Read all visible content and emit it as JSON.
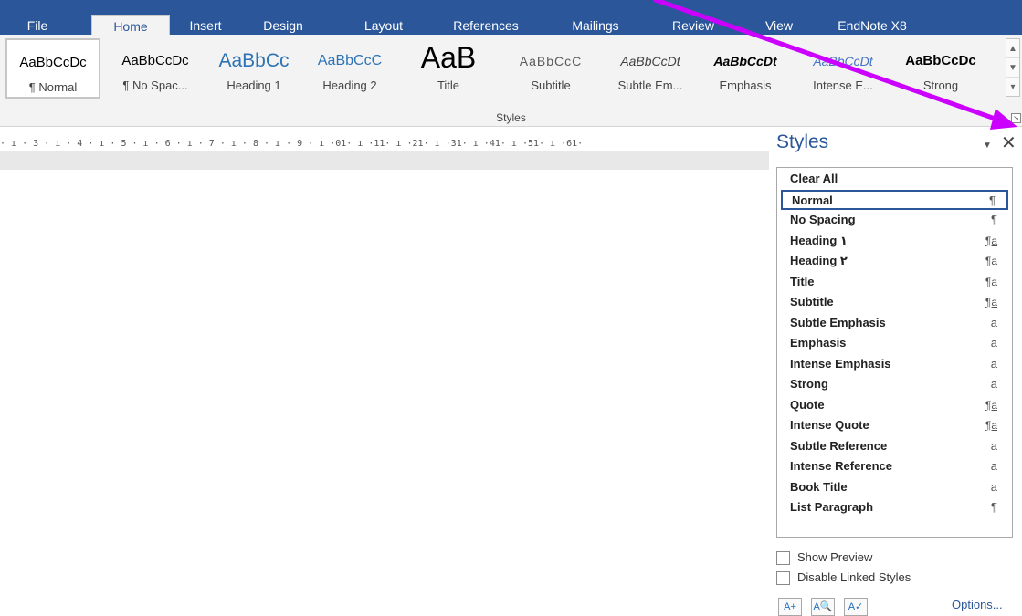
{
  "ribbon": {
    "tabs": [
      "File",
      "Home",
      "Insert",
      "Design",
      "Layout",
      "References",
      "Mailings",
      "Review",
      "View",
      "EndNote X8"
    ],
    "active_tab": "Home",
    "styles_group_label": "Styles",
    "gallery": [
      {
        "preview": "AaBbCcDc",
        "name": "¶ Normal"
      },
      {
        "preview": "AaBbCcDc",
        "name": "¶ No Spac..."
      },
      {
        "preview": "AaBbCc",
        "name": "Heading 1"
      },
      {
        "preview": "AaBbCcC",
        "name": "Heading 2"
      },
      {
        "preview": "AaB",
        "name": "Title"
      },
      {
        "preview": "AaBbCcC",
        "name": "Subtitle"
      },
      {
        "preview": "AaBbCcDt",
        "name": "Subtle Em..."
      },
      {
        "preview": "AaBbCcDt",
        "name": "Emphasis"
      },
      {
        "preview": "AaBbCcDt",
        "name": "Intense E..."
      },
      {
        "preview": "AaBbCcDc",
        "name": "Strong"
      }
    ]
  },
  "ruler": {
    "text": "· ı · 3 · ı · 4 · ı · 5 · ı · 6 · ı · 7 · ı · 8 · ı · 9 · ı ·01· ı ·11· ı ·21· ı ·31· ı ·41· ı ·51· ı ·61·"
  },
  "styles_pane": {
    "title": "Styles",
    "menu_icon": "▼",
    "close_icon": "✕",
    "items": [
      {
        "label": "Clear All",
        "glyph": ""
      },
      {
        "label": "Normal",
        "glyph": "¶"
      },
      {
        "label": "No Spacing",
        "glyph": "¶"
      },
      {
        "label": "Heading ١",
        "glyph": "¶a"
      },
      {
        "label": "Heading ٢",
        "glyph": "¶a"
      },
      {
        "label": "Title",
        "glyph": "¶a"
      },
      {
        "label": "Subtitle",
        "glyph": "¶a"
      },
      {
        "label": "Subtle Emphasis",
        "glyph": "a"
      },
      {
        "label": "Emphasis",
        "glyph": "a"
      },
      {
        "label": "Intense Emphasis",
        "glyph": "a"
      },
      {
        "label": "Strong",
        "glyph": "a"
      },
      {
        "label": "Quote",
        "glyph": "¶a"
      },
      {
        "label": "Intense Quote",
        "glyph": "¶a"
      },
      {
        "label": "Subtle Reference",
        "glyph": "a"
      },
      {
        "label": "Intense Reference",
        "glyph": "a"
      },
      {
        "label": "Book Title",
        "glyph": "a"
      },
      {
        "label": "List Paragraph",
        "glyph": "¶"
      }
    ],
    "selected_item": "Normal",
    "show_preview_label": "Show Preview",
    "disable_linked_label": "Disable Linked Styles",
    "options_label": "Options...",
    "buttons": [
      "new-style-icon",
      "style-inspector-icon",
      "manage-styles-icon"
    ]
  },
  "colors": {
    "ribbon_blue": "#2b579a",
    "annotation_arrow": "#cc00ff"
  }
}
